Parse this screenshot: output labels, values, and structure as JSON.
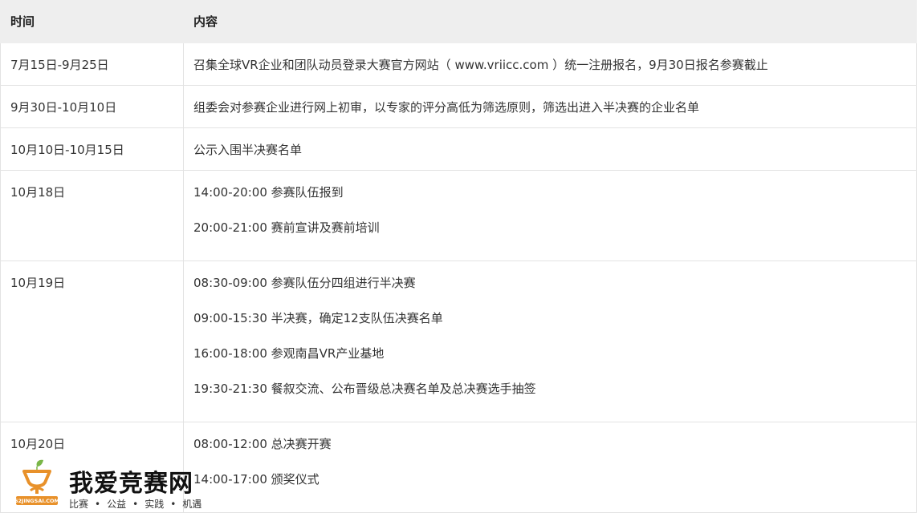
{
  "table": {
    "headers": {
      "time": "时间",
      "content": "内容"
    },
    "rows": [
      {
        "time": "7月15日-9月25日",
        "lines": [
          "召集全球VR企业和团队动员登录大赛官方网站（ www.vriicc.com ）统一注册报名，9月30日报名参赛截止"
        ]
      },
      {
        "time": "9月30日-10月10日",
        "lines": [
          "组委会对参赛企业进行网上初审，以专家的评分高低为筛选原则，筛选出进入半决赛的企业名单"
        ]
      },
      {
        "time": "10月10日-10月15日",
        "lines": [
          "公示入围半决赛名单"
        ]
      },
      {
        "time": "10月18日",
        "lines": [
          "14:00-20:00 参赛队伍报到",
          "20:00-21:00 赛前宣讲及赛前培训"
        ]
      },
      {
        "time": "10月19日",
        "lines": [
          "08:30-09:00 参赛队伍分四组进行半决赛",
          "09:00-15:30 半决赛，确定12支队伍决赛名单",
          "16:00-18:00 参观南昌VR产业基地",
          "19:30-21:30 餐叙交流、公布晋级总决赛名单及总决赛选手抽签"
        ]
      },
      {
        "time": "10月20日",
        "lines": [
          "08:00-12:00 总决赛开赛",
          "14:00-17:00 颁奖仪式"
        ]
      }
    ]
  },
  "watermark": {
    "title": "我爱竞赛网",
    "domain": "52JINGSAI.COM",
    "tags": [
      "比赛",
      "公益",
      "实践",
      "机遇"
    ],
    "colors": {
      "orange": "#e8912a",
      "green": "#7ab648",
      "dark": "#111111"
    }
  }
}
